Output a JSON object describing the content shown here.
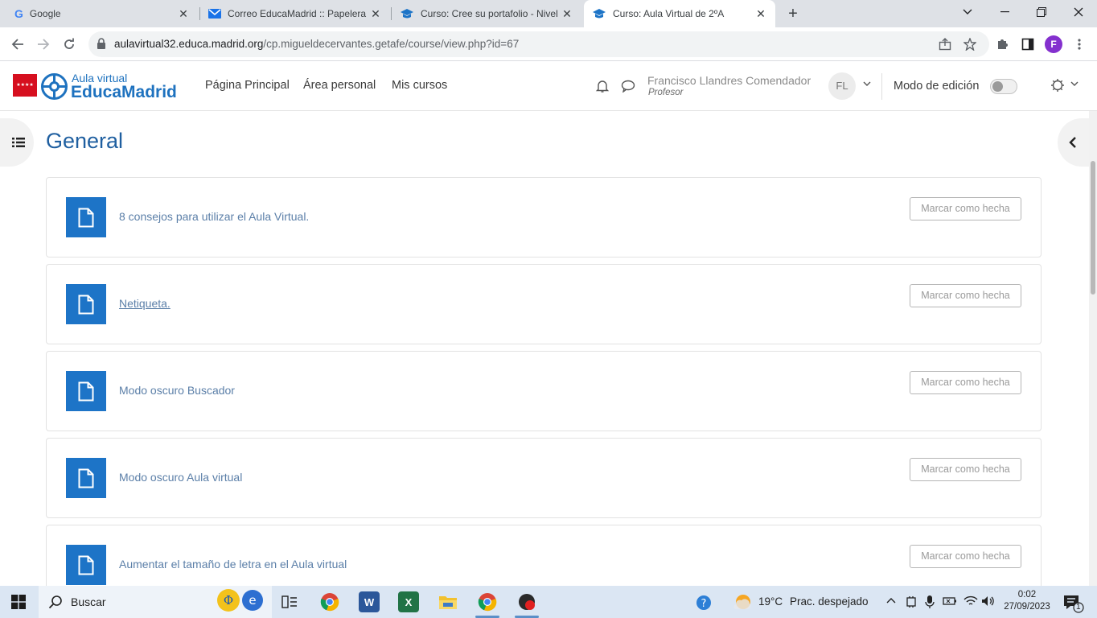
{
  "browser": {
    "tabs": [
      {
        "title": "Google",
        "icon": "google-icon"
      },
      {
        "title": "Correo EducaMadrid :: Papelera",
        "icon": "mail-icon"
      },
      {
        "title": "Curso: Cree su portafolio - Nivel I",
        "icon": "graduation-cap-icon"
      },
      {
        "title": "Curso: Aula Virtual de 2ºA",
        "icon": "graduation-cap-icon"
      }
    ],
    "url_host": "aulavirtual32.educa.madrid.org",
    "url_path": "/cp.migueldecervantes.getafe/course/view.php?id=67",
    "profile_initial": "F"
  },
  "navbar": {
    "logo_small": "Aula virtual",
    "logo_big": "EducaMadrid",
    "links": [
      "Página Principal",
      "Área personal",
      "Mis cursos"
    ],
    "user_name": "Francisco Llandres Comendador",
    "user_role": "Profesor",
    "user_initials": "FL",
    "edit_mode_label": "Modo de edición",
    "edit_mode_on": false
  },
  "course": {
    "section_title": "General",
    "activities": [
      {
        "name": "8 consejos para utilizar el Aula Virtual.",
        "button": "Marcar como hecha"
      },
      {
        "name": "Netiqueta.",
        "button": "Marcar como hecha"
      },
      {
        "name": "Modo oscuro Buscador",
        "button": "Marcar como hecha"
      },
      {
        "name": "Modo oscuro Aula virtual",
        "button": "Marcar como hecha"
      },
      {
        "name": "Aumentar el tamaño de letra en el Aula virtual",
        "button": "Marcar como hecha"
      }
    ]
  },
  "taskbar": {
    "search_label": "Buscar",
    "weather": "19°C",
    "weather_desc": "Prac. despejado",
    "time": "0:02",
    "date": "27/09/2023",
    "notifications": "1"
  },
  "colors": {
    "brand_blue": "#1d74c7",
    "title_blue": "#1f5fa0",
    "flag_red": "#d60f1f"
  }
}
